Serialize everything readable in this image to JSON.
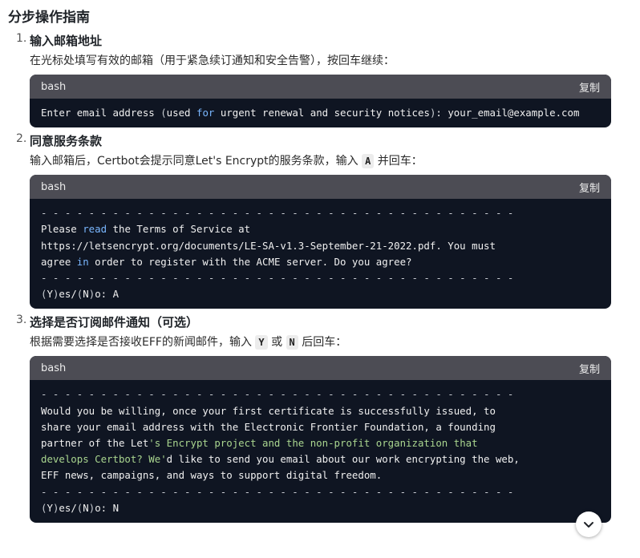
{
  "heading": "分步操作指南",
  "copy_label": "复制",
  "steps": [
    {
      "number": "1.",
      "title": "输入邮箱地址",
      "desc": "在光标处填写有效的邮箱（用于紧急续订通知和安全告警），按回车继续：",
      "lang": "bash",
      "code": {
        "l1a": "Enter email address ",
        "l1p1": "(",
        "l1b": "used ",
        "l1kw": "for",
        "l1c": " urgent renewal and security notices",
        "l1p2": ")",
        "l1d": ": your_email@example.com"
      }
    },
    {
      "number": "2.",
      "title": "同意服务条款",
      "desc_before": "输入邮箱后，Certbot会提示同意Let's Encrypt的服务条款，输入",
      "key": "A",
      "desc_after": "并回车：",
      "lang": "bash",
      "code": {
        "sep": "- - - - - - - - - - - - - - - - - - - - - - - - - - - - - - - - - - - - - - - -",
        "l1a": "Please ",
        "l1kw": "read",
        "l1b": " the Terms of Service at",
        "l2": "https://letsencrypt.org/documents/LE-SA-v1.3-September-21-2022.pdf. You must",
        "l3a": "agree ",
        "l3kw": "in",
        "l3b": " order to register with the ACME server. Do you agree?",
        "yes_p1": "(",
        "yes_y": "Y",
        "yes_p2": ")",
        "yes_mid": "es/",
        "yes_p3": "(",
        "yes_n": "N",
        "yes_p4": ")",
        "yes_end": "o: A"
      }
    },
    {
      "number": "3.",
      "title": "选择是否订阅邮件通知（可选）",
      "desc_before": "根据需要选择是否接收EFF的新闻邮件，输入",
      "key1": "Y",
      "or": "或",
      "key2": "N",
      "desc_after": "后回车：",
      "lang": "bash",
      "code": {
        "sep": "- - - - - - - - - - - - - - - - - - - - - - - - - - - - - - - - - - - - - - - -",
        "l1": "Would you be willing, once your first certificate is successfully issued, to",
        "l2": "share your email address with the Electronic Frontier Foundation, a founding",
        "l3a": "partner of the Let",
        "l3s": "'s Encrypt project and the non-profit organization that",
        "l4s": "develops Certbot? We'",
        "l4b": "d like to send you email about our work encrypting the web,",
        "l5": "EFF news, campaigns, and ways to support digital freedom.",
        "yes_p1": "(",
        "yes_y": "Y",
        "yes_p2": ")",
        "yes_mid": "es/",
        "yes_p3": "(",
        "yes_n": "N",
        "yes_p4": ")",
        "yes_end": "o: N"
      }
    }
  ],
  "scroll_button_icon": "chevron-down-icon"
}
